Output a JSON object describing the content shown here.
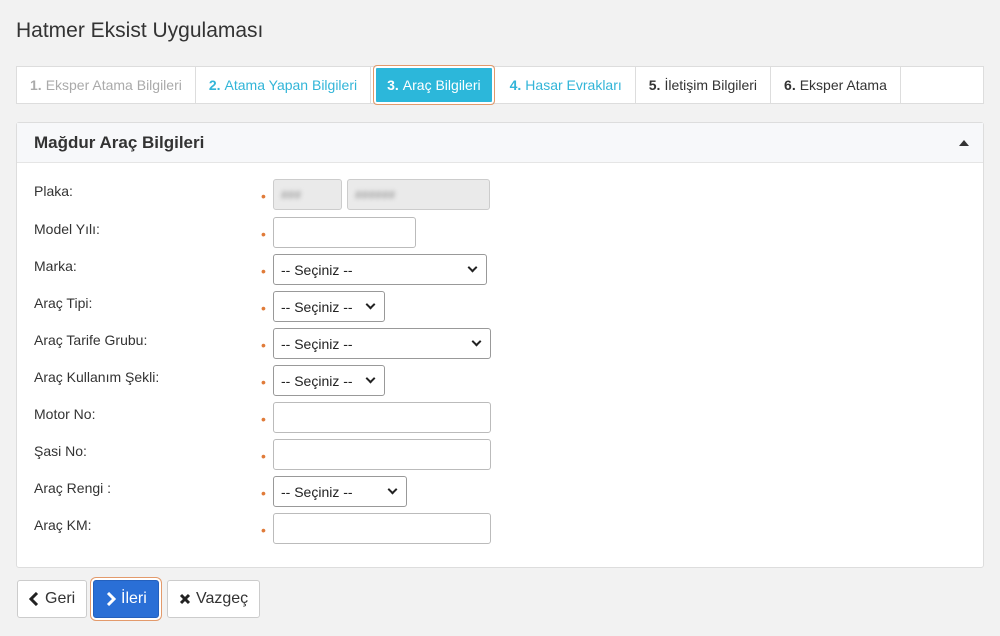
{
  "app": {
    "title": "Hatmer Eksist Uygulaması"
  },
  "steps": [
    {
      "num": "1.",
      "label": "Eksper Atama Bilgileri",
      "state": "disabled"
    },
    {
      "num": "2.",
      "label": "Atama Yapan Bilgileri",
      "state": "done"
    },
    {
      "num": "3.",
      "label": "Araç Bilgileri",
      "state": "active"
    },
    {
      "num": "4.",
      "label": "Hasar Evrakları",
      "state": "done"
    },
    {
      "num": "5.",
      "label": "İletişim Bilgileri",
      "state": "todo"
    },
    {
      "num": "6.",
      "label": "Eksper Atama",
      "state": "todo"
    }
  ],
  "panel": {
    "title": "Mağdur Araç Bilgileri",
    "fields": {
      "plaka": {
        "label": "Plaka:",
        "value1": "###",
        "value2": "######"
      },
      "model_yili": {
        "label": "Model Yılı:",
        "value": ""
      },
      "marka": {
        "label": "Marka:",
        "selected": "-- Seçiniz --"
      },
      "arac_tipi": {
        "label": "Araç Tipi:",
        "selected": "-- Seçiniz --"
      },
      "tarife_grubu": {
        "label": "Araç Tarife Grubu:",
        "selected": "-- Seçiniz --"
      },
      "kullanim_sekli": {
        "label": "Araç Kullanım Şekli:",
        "selected": "-- Seçiniz --"
      },
      "motor_no": {
        "label": "Motor No:",
        "value": ""
      },
      "sasi_no": {
        "label": "Şasi No:",
        "value": ""
      },
      "renk": {
        "label": "Araç Rengi :",
        "selected": "-- Seçiniz --"
      },
      "km": {
        "label": "Araç KM:",
        "value": ""
      }
    },
    "required_mark": "•"
  },
  "footer": {
    "back_label": "Geri",
    "next_label": "İleri",
    "cancel_label": "Vazgeç"
  },
  "colors": {
    "accent": "#2cb7da",
    "primary": "#2a6fd6",
    "required": "#e07b39"
  }
}
